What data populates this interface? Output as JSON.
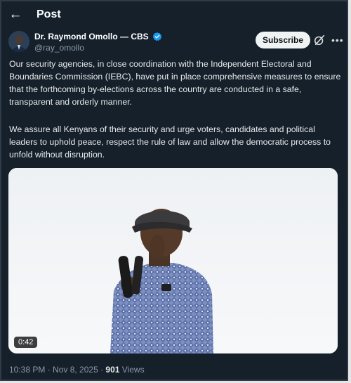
{
  "header": {
    "back_icon": "back-arrow-icon",
    "title": "Post"
  },
  "author": {
    "name": "Dr. Raymond Omollo — CBS",
    "handle": "@ray_omollo",
    "verified": true,
    "verified_color": "#1d9bf0"
  },
  "actions": {
    "subscribe_label": "Subscribe",
    "grok_icon": "grok-icon",
    "more_icon": "more-options-icon"
  },
  "tweet": {
    "paragraphs": [
      "Our security agencies, in close coordination with the Independent Electoral and Boundaries Commission (IEBC), have put in place comprehensive measures to ensure that the forthcoming by-elections across the country are conducted in a safe, transparent and orderly manner.",
      "We assure all Kenyans of their security and urge voters, candidates and political leaders to uphold peace, respect the rule of law and allow the democratic process to unfold without disruption."
    ]
  },
  "media": {
    "type": "video",
    "duration": "0:42"
  },
  "meta": {
    "timestamp": "10:38 PM · Nov 8, 2025 · ",
    "views_count": "901",
    "views_label": " Views"
  },
  "colors": {
    "background": "#15202b",
    "text": "#e7e9ea",
    "muted": "#8b98a5",
    "accent": "#1d9bf0"
  }
}
